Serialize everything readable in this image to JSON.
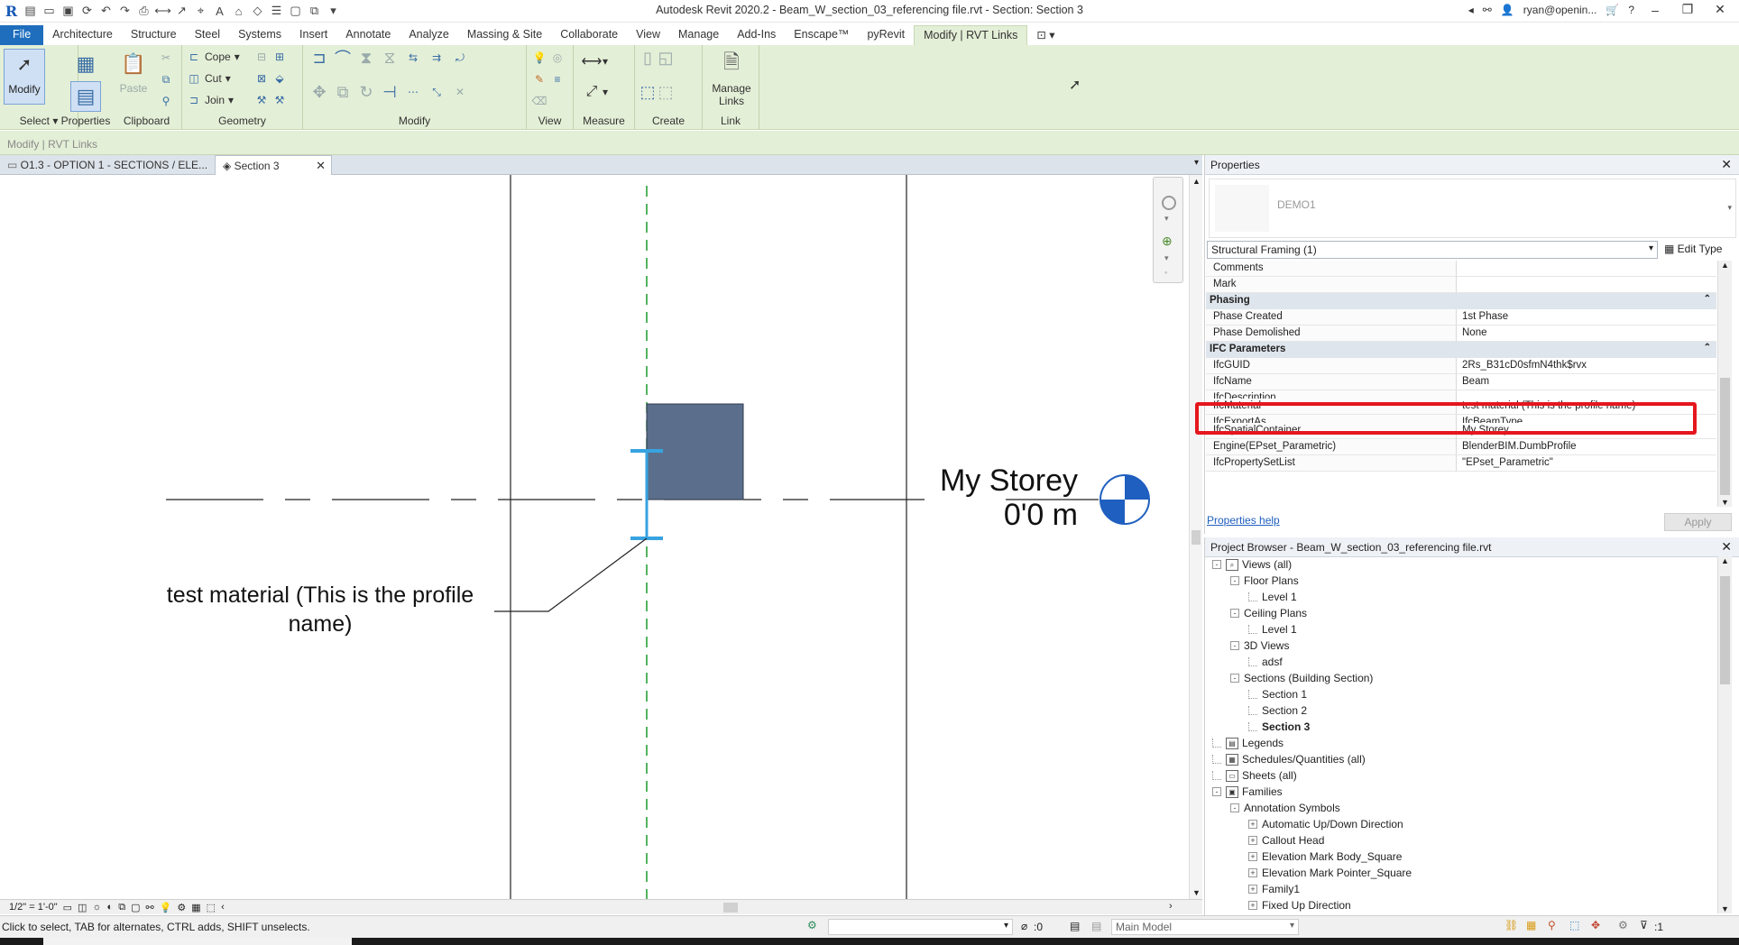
{
  "window": {
    "title": "Autodesk Revit 2020.2 - Beam_W_section_03_referencing file.rvt - Section: Section 3",
    "user": "ryan@openin...",
    "help": "?"
  },
  "ribbon_tabs": [
    "File",
    "Architecture",
    "Structure",
    "Steel",
    "Systems",
    "Insert",
    "Annotate",
    "Analyze",
    "Massing & Site",
    "Collaborate",
    "View",
    "Manage",
    "Add-Ins",
    "Enscape™",
    "pyRevit",
    "Modify | RVT Links"
  ],
  "ribbon": {
    "select_label": "Select",
    "modify_label": "Modify",
    "properties_label": "Properties",
    "clipboard_label": "Clipboard",
    "paste_label": "Paste",
    "geometry_label": "Geometry",
    "cope_label": "Cope",
    "cut_label": "Cut",
    "join_label": "Join",
    "modify_panel_label": "Modify",
    "view_panel_label": "View",
    "measure_panel_label": "Measure",
    "create_panel_label": "Create",
    "link_panel_label": "Link",
    "manage_links_line1": "Manage",
    "manage_links_line2": "Links"
  },
  "context_bar": "Modify | RVT Links",
  "view_tabs": [
    {
      "label": "O1.3 - OPTION 1 - SECTIONS / ELE..."
    },
    {
      "label": "Section 3"
    }
  ],
  "canvas": {
    "annotation_line1": "test material (This is the profile",
    "annotation_line2": "name)",
    "level_name": "My Storey",
    "level_elevation": "0'0 m"
  },
  "view_bar": {
    "scale": "1/2\" = 1'-0\""
  },
  "status": {
    "hint": "Click to select, TAB for alternates, CTRL adds, SHIFT unselects.",
    "workset_count": ":0",
    "design_option": "Main Model",
    "filter_count": ":1"
  },
  "properties": {
    "title": "Properties",
    "type_name": "DEMO1",
    "category_selector": "Structural Framing (1)",
    "edit_type": "Edit Type",
    "rows": [
      {
        "kind": "param",
        "name": "Comments",
        "value": ""
      },
      {
        "kind": "param",
        "name": "Mark",
        "value": ""
      },
      {
        "kind": "group",
        "name": "Phasing"
      },
      {
        "kind": "param",
        "name": "Phase Created",
        "value": "1st Phase"
      },
      {
        "kind": "param",
        "name": "Phase Demolished",
        "value": "None"
      },
      {
        "kind": "group",
        "name": "IFC Parameters"
      },
      {
        "kind": "param",
        "name": "IfcGUID",
        "value": "2Rs_B31cD0sfmN4thk$rvx"
      },
      {
        "kind": "param",
        "name": "IfcName",
        "value": "Beam"
      },
      {
        "kind": "clipped",
        "name": "IfcDescription",
        "value": ""
      },
      {
        "kind": "param",
        "name": "IfcMaterial",
        "value": "test material (This is the profile name)"
      },
      {
        "kind": "clipped",
        "name": "IfcExportAs",
        "value": "IfcBeamType"
      },
      {
        "kind": "param",
        "name": "IfcSpatialContainer",
        "value": "My Storey"
      },
      {
        "kind": "param",
        "name": "Engine(EPset_Parametric)",
        "value": "BlenderBIM.DumbProfile"
      },
      {
        "kind": "param",
        "name": "IfcPropertySetList",
        "value": "\"EPset_Parametric\""
      }
    ],
    "help_link": "Properties help",
    "apply": "Apply"
  },
  "project_browser": {
    "title": "Project Browser - Beam_W_section_03_referencing file.rvt",
    "nodes": [
      {
        "label": "Views (all)",
        "level": 0,
        "toggle": "-",
        "icon": "views"
      },
      {
        "label": "Floor Plans",
        "level": 1,
        "toggle": "-"
      },
      {
        "label": "Level 1",
        "level": 2
      },
      {
        "label": "Ceiling Plans",
        "level": 1,
        "toggle": "-"
      },
      {
        "label": "Level 1",
        "level": 2
      },
      {
        "label": "3D Views",
        "level": 1,
        "toggle": "-"
      },
      {
        "label": "adsf",
        "level": 2
      },
      {
        "label": "Sections (Building Section)",
        "level": 1,
        "toggle": "-"
      },
      {
        "label": "Section 1",
        "level": 2
      },
      {
        "label": "Section 2",
        "level": 2
      },
      {
        "label": "Section 3",
        "level": 2,
        "bold": true
      },
      {
        "label": "Legends",
        "level": 0,
        "icon": "legend"
      },
      {
        "label": "Schedules/Quantities (all)",
        "level": 0,
        "icon": "schedule"
      },
      {
        "label": "Sheets (all)",
        "level": 0,
        "icon": "sheet"
      },
      {
        "label": "Families",
        "level": 0,
        "toggle": "-",
        "icon": "family"
      },
      {
        "label": "Annotation Symbols",
        "level": 1,
        "toggle": "-"
      },
      {
        "label": "Automatic Up/Down Direction",
        "level": 2,
        "toggle": "+"
      },
      {
        "label": "Callout Head",
        "level": 2,
        "toggle": "+"
      },
      {
        "label": "Elevation Mark Body_Square",
        "level": 2,
        "toggle": "+"
      },
      {
        "label": "Elevation Mark Pointer_Square",
        "level": 2,
        "toggle": "+"
      },
      {
        "label": "Family1",
        "level": 2,
        "toggle": "+"
      },
      {
        "label": "Fixed Up Direction",
        "level": 2,
        "toggle": "+"
      }
    ]
  },
  "colors": {
    "ribbon_bg": "#e4efd7",
    "file_tab": "#1f6ebd",
    "beam_fill": "#5b6f8c",
    "highlight": "#e5161d",
    "grid_line": "#1a9a2a",
    "level_head": "#1f5fbf"
  }
}
